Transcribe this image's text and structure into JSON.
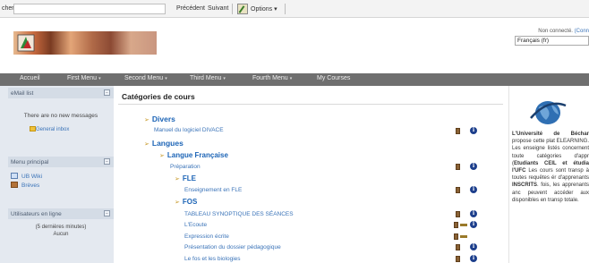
{
  "findbar": {
    "label": "cher :",
    "previous": "Précédent",
    "next": "Suivant",
    "options": "Options ▾"
  },
  "header": {
    "not_connected": "Non connecté.",
    "login": "(Conn",
    "language": "Français (fr)"
  },
  "nav": {
    "items": [
      {
        "label": "Accueil",
        "caret": ""
      },
      {
        "label": "First Menu",
        "caret": "▾"
      },
      {
        "label": "Second Menu",
        "caret": "▾"
      },
      {
        "label": "Third Menu",
        "caret": "▾"
      },
      {
        "label": "Fourth Menu",
        "caret": "▾"
      },
      {
        "label": "My Courses",
        "caret": ""
      }
    ]
  },
  "sidebar": {
    "mail": {
      "title": "eMail list",
      "message": "There are no new messages",
      "inbox": "General inbox"
    },
    "menu": {
      "title": "Menu principal",
      "items": [
        "UB Wiki",
        "Brèves"
      ]
    },
    "online": {
      "title": "Utilisateurs en ligne",
      "period": "(5 dernières minutes)",
      "none": "Aucun"
    }
  },
  "main": {
    "title": "Catégories de cours",
    "tree": [
      {
        "type": "category",
        "label": "Divers"
      },
      {
        "type": "course",
        "label": "Manuel du logiciel DIVACE"
      },
      {
        "type": "category",
        "label": "Langues"
      },
      {
        "type": "category",
        "label": "Langue Française"
      },
      {
        "type": "course",
        "label": "Préparation"
      },
      {
        "type": "category",
        "label": "FLE"
      },
      {
        "type": "course",
        "label": "Enseignement en FLE"
      },
      {
        "type": "category",
        "label": "FOS"
      },
      {
        "type": "course",
        "label": "TABLEAU SYNOPTIQUE DES SÉANCES"
      },
      {
        "type": "course",
        "label": "L'Ecoute"
      },
      {
        "type": "course",
        "label": "Expression écrite"
      },
      {
        "type": "course",
        "label": "Présentation du dossier pédagogique"
      },
      {
        "type": "course",
        "label": "Le fos et les biologies"
      }
    ]
  },
  "right": {
    "text_html": "<b>L'Université de Béchar</b> propose cette plat ELEARNING. Les enseigne listés concernent toute catégories d'appr (<b>Etudiants CEIL et étudia</b> <b>l'UFC</b> Les cours sont transp à toutes requêtes ér d'apprenants <b>INSCRITS</b>. fois, les apprenants anc peuvent accéder aux disponibles en transp totale."
  },
  "colors": {
    "nav_bg": "#6f6f6f",
    "link": "#3a73b8",
    "category": "#1c64b6",
    "sidebar_bg": "#e4e9f0"
  }
}
